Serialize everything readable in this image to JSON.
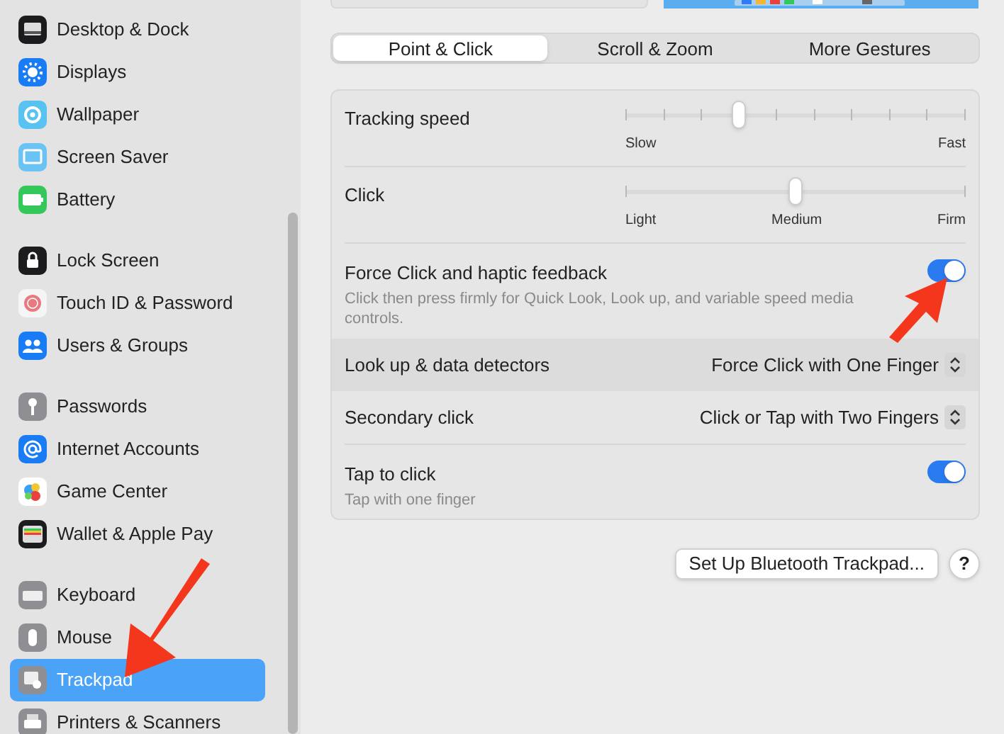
{
  "sidebar": {
    "groups": [
      {
        "items": [
          {
            "label": "Desktop & Dock",
            "selected": false
          },
          {
            "label": "Displays",
            "selected": false
          },
          {
            "label": "Wallpaper",
            "selected": false
          },
          {
            "label": "Screen Saver",
            "selected": false
          },
          {
            "label": "Battery",
            "selected": false
          }
        ]
      },
      {
        "items": [
          {
            "label": "Lock Screen",
            "selected": false
          },
          {
            "label": "Touch ID & Password",
            "selected": false
          },
          {
            "label": "Users & Groups",
            "selected": false
          }
        ]
      },
      {
        "items": [
          {
            "label": "Passwords",
            "selected": false
          },
          {
            "label": "Internet Accounts",
            "selected": false
          },
          {
            "label": "Game Center",
            "selected": false
          },
          {
            "label": "Wallet & Apple Pay",
            "selected": false
          }
        ]
      },
      {
        "items": [
          {
            "label": "Keyboard",
            "selected": false
          },
          {
            "label": "Mouse",
            "selected": false
          },
          {
            "label": "Trackpad",
            "selected": true
          },
          {
            "label": "Printers & Scanners",
            "selected": false
          }
        ]
      }
    ]
  },
  "tabs": [
    {
      "label": "Point & Click",
      "selected": true
    },
    {
      "label": "Scroll & Zoom",
      "selected": false
    },
    {
      "label": "More Gestures",
      "selected": false
    }
  ],
  "settings": [
    {
      "kind": "slider",
      "label": "Tracking speed",
      "level": 0.335,
      "ticks": [
        "Slow",
        "Fast"
      ]
    },
    {
      "kind": "slider",
      "label": "Click",
      "level": 0.5,
      "ticks": [
        "Light",
        "Medium",
        "Firm"
      ]
    },
    {
      "kind": "toggle",
      "label": "Force Click and haptic feedback",
      "description": "Click then press firmly for Quick Look, Look up, and variable speed media controls.",
      "on": true
    },
    {
      "kind": "popup",
      "label": "Look up & data detectors",
      "value": "Force Click with One Finger",
      "highlighted": true
    },
    {
      "kind": "popup",
      "label": "Secondary click",
      "value": "Click or Tap with Two Fingers",
      "highlighted": false
    },
    {
      "kind": "toggle",
      "label": "Tap to click",
      "description": "Tap with one finger",
      "on": true
    }
  ],
  "setup_button": "Set Up Bluetooth Trackpad...",
  "help_button": "?"
}
